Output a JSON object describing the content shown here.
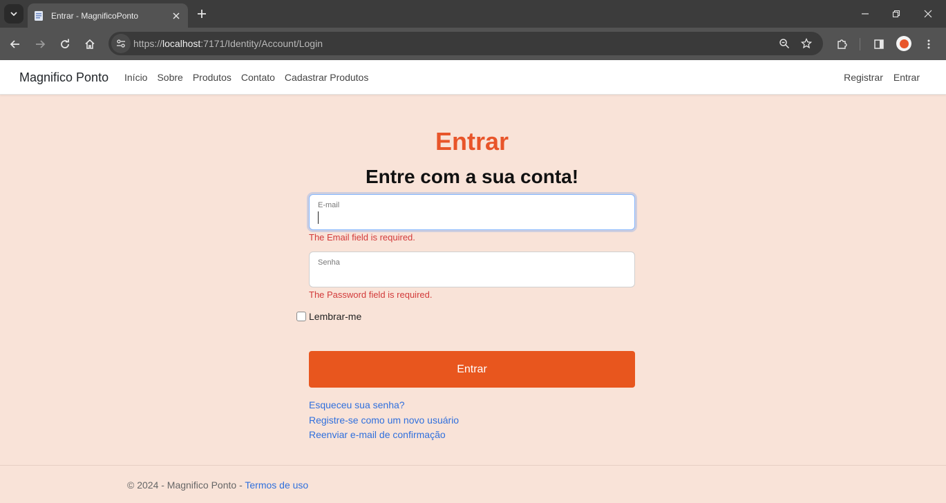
{
  "browser": {
    "tab_title": "Entrar - MagnificoPonto",
    "url_scheme": "https://",
    "url_host": "localhost",
    "url_path": ":7171/Identity/Account/Login"
  },
  "navbar": {
    "brand": "Magnifico Ponto",
    "links": [
      "Início",
      "Sobre",
      "Produtos",
      "Contato",
      "Cadastrar Produtos"
    ],
    "right_links": [
      "Registrar",
      "Entrar"
    ]
  },
  "login": {
    "title": "Entrar",
    "subtitle": "Entre com a sua conta!",
    "email_label": "E-mail",
    "email_value": "",
    "email_error": "The Email field is required.",
    "password_label": "Senha",
    "password_value": "",
    "password_error": "The Password field is required.",
    "remember_label": "Lembrar-me",
    "remember_checked": false,
    "submit_label": "Entrar",
    "links": [
      "Esqueceu sua senha?",
      "Registre-se como um novo usuário",
      "Reenviar e-mail de confirmação"
    ]
  },
  "footer": {
    "text": "© 2024 - Magnifico Ponto - ",
    "terms_link": "Termos de uso"
  },
  "colors": {
    "accent": "#e8552a",
    "page_bg": "#f9e3d8",
    "link": "#2f6fdd",
    "error": "#d23a3a"
  }
}
